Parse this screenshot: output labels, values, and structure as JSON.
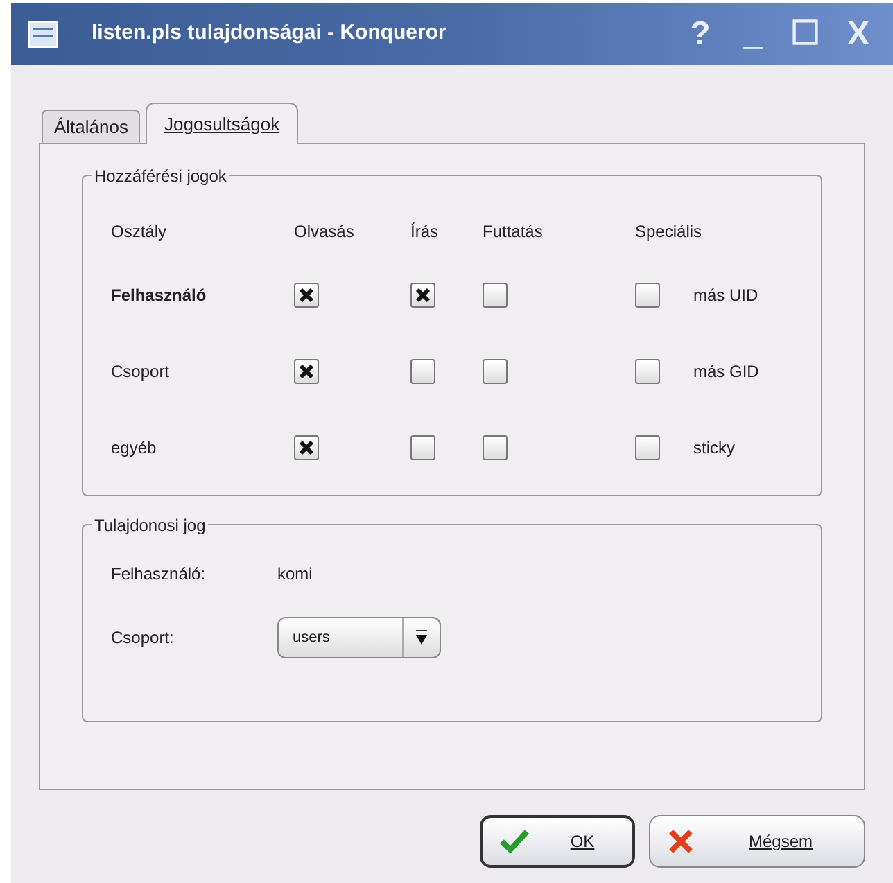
{
  "window": {
    "title": "listen.pls tulajdonságai - Konqueror",
    "buttons": [
      "?",
      "_",
      "☐",
      "X"
    ]
  },
  "tabs": [
    {
      "label": "Általános",
      "selected": false
    },
    {
      "label": "Jogosultságok",
      "selected": true
    }
  ],
  "access_group": {
    "title": "Hozzáférési jogok",
    "columns": [
      "Osztály",
      "Olvasás",
      "Írás",
      "Futtatás",
      "Speciális"
    ],
    "rows": [
      {
        "label": "Felhasználó",
        "read": true,
        "write": true,
        "exec": false,
        "special": false,
        "special_label": "más UID"
      },
      {
        "label": "Csoport",
        "read": true,
        "write": false,
        "exec": false,
        "special": false,
        "special_label": "más GID"
      },
      {
        "label": "egyéb",
        "read": true,
        "write": false,
        "exec": false,
        "special": false,
        "special_label": "sticky"
      }
    ]
  },
  "owner_group": {
    "title": "Tulajdonosi jog",
    "user_label": "Felhasználó:",
    "user_value": "komi",
    "group_label": "Csoport:",
    "group_value": "users"
  },
  "buttons": [
    {
      "label": "OK",
      "kind": "ok"
    },
    {
      "label": "Mégsem",
      "kind": "cancel"
    }
  ]
}
